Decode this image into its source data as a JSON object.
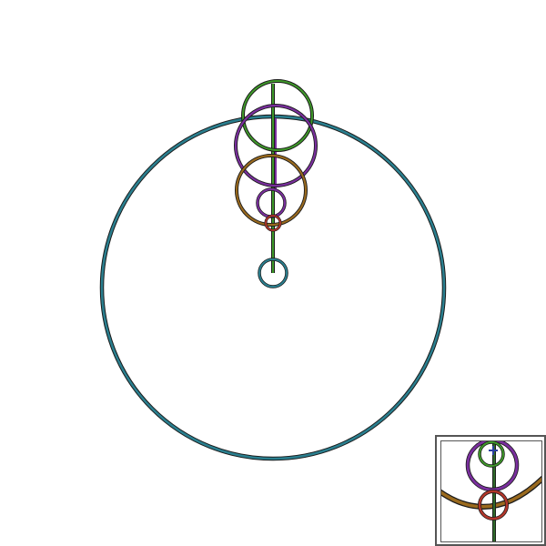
{
  "scene": {
    "colors": {
      "teal": "#2a7f8f",
      "green": "#3f9a2a",
      "purple": "#7a2f9e",
      "brown": "#9a6a1e",
      "red": "#b2362a",
      "darkGreen": "#2f6a2a",
      "outline": "#1a1a1a",
      "minimapBorder": "#555555"
    },
    "icons": [
      "ring-icon",
      "rod-icon",
      "minimap-frame-icon"
    ]
  }
}
